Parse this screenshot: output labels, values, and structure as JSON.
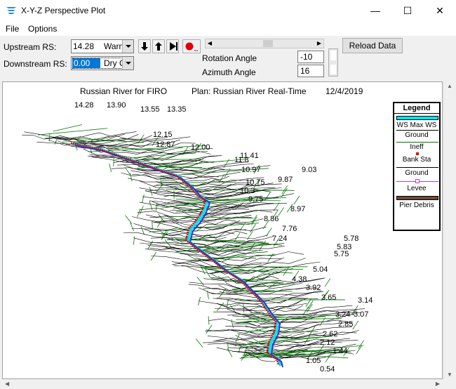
{
  "window": {
    "title": "X-Y-Z Perspective Plot",
    "minimize_glyph": "—",
    "maximize_glyph": "☐",
    "close_glyph": "✕"
  },
  "menu": [
    "File",
    "Options"
  ],
  "toolbar": {
    "upstream_label": "Upstream RS:",
    "upstream_rs": "14.28",
    "upstream_desc": "Warm",
    "downstream_label": "Downstream RS:",
    "downstream_rs": "0.00",
    "downstream_desc": "Dry Cr",
    "rotation_label": "Rotation Angle",
    "rotation_value": "-10",
    "azimuth_label": "Azimuth Angle",
    "azimuth_value": "16",
    "reload_label": "Reload Data",
    "icons": [
      "arrow-down-icon",
      "arrow-up-icon",
      "play-icon",
      "record-icon"
    ]
  },
  "plot": {
    "title": "Russian River for FIRO",
    "plan": "Plan: Russian River Real-Time",
    "date": "12/4/2019",
    "rs_labels": [
      "14.28",
      "13.90",
      "13.55",
      "13.35",
      "12.15",
      "12.87",
      "12.00",
      "11.41",
      "11.8",
      "10.97",
      "9.03",
      "10.75",
      "9.87",
      "10.3",
      "9.75",
      "8.97",
      "8.86",
      "7.76",
      "7.24",
      "5.78",
      "5.83",
      "5.75",
      "5.04",
      "4.38",
      "3.92",
      "3.65",
      "3.14",
      "3.24",
      "3.07",
      "2.85",
      "2.62",
      "2.12",
      "1.44",
      "1.05",
      "0.54"
    ]
  },
  "legend": {
    "title": "Legend",
    "items": [
      "WS Max WS",
      "Ground",
      "Ineff",
      "Bank Sta",
      "Ground",
      "Levee",
      "Pier Debris"
    ]
  },
  "colors": {
    "ws": "#00e5ee",
    "ground": "#000000",
    "ineff": "#007800",
    "bank": "#e00000",
    "levee": "#c040c0",
    "pier": "#6b4a3a",
    "accent": "#0078d7"
  }
}
